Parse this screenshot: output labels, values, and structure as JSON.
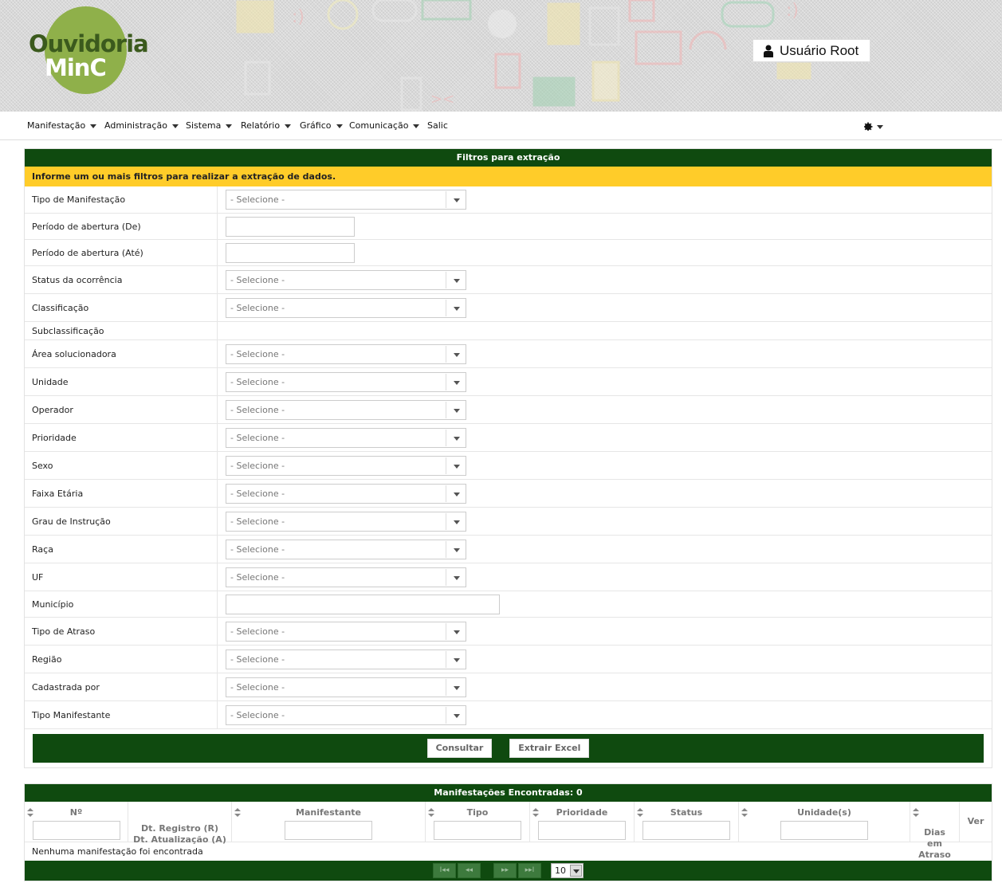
{
  "header": {
    "logo_line1": "Ouvidoria",
    "logo_line2": "MinC",
    "user_label": "Usuário Root"
  },
  "nav": {
    "items": [
      {
        "label": "Manifestação",
        "dropdown": true
      },
      {
        "label": "Administração",
        "dropdown": true
      },
      {
        "label": "Sistema",
        "dropdown": true
      },
      {
        "label": "Relatório",
        "dropdown": true
      },
      {
        "label": "Gráfico",
        "dropdown": true
      },
      {
        "label": "Comunicação",
        "dropdown": true
      },
      {
        "label": "Salic",
        "dropdown": false
      }
    ],
    "settings_icon": "gear-icon"
  },
  "filters": {
    "title": "Filtros para extração",
    "notice": "Informe um ou mais filtros para realizar a extração de dados.",
    "placeholder": "- Selecione -",
    "fields": [
      {
        "label": "Tipo de Manifestação",
        "kind": "select"
      },
      {
        "label": "Período de abertura (De)",
        "kind": "text"
      },
      {
        "label": "Período de abertura (Até)",
        "kind": "text"
      },
      {
        "label": "Status da ocorrência",
        "kind": "select"
      },
      {
        "label": "Classificação",
        "kind": "select"
      },
      {
        "label": "Subclassificação",
        "kind": "none"
      },
      {
        "label": "Área solucionadora",
        "kind": "select"
      },
      {
        "label": "Unidade",
        "kind": "select"
      },
      {
        "label": "Operador",
        "kind": "select"
      },
      {
        "label": "Prioridade",
        "kind": "select"
      },
      {
        "label": "Sexo",
        "kind": "select"
      },
      {
        "label": "Faixa Etária",
        "kind": "select"
      },
      {
        "label": "Grau de Instrução",
        "kind": "select"
      },
      {
        "label": "Raça",
        "kind": "select"
      },
      {
        "label": "UF",
        "kind": "select"
      },
      {
        "label": "Município",
        "kind": "wide-text"
      },
      {
        "label": "Tipo de Atraso",
        "kind": "select"
      },
      {
        "label": "Região",
        "kind": "select"
      },
      {
        "label": "Cadastrada por",
        "kind": "select"
      },
      {
        "label": "Tipo Manifestante",
        "kind": "select"
      }
    ],
    "consult_label": "Consultar",
    "export_label": "Extrair Excel"
  },
  "results": {
    "title": "Manifestações Encontradas: 0",
    "columns": [
      {
        "label": "Nº",
        "sortable": true,
        "filter": true
      },
      {
        "label": "Dt. Registro (R)\nDt. Atualização (A)",
        "sortable": false,
        "filter": false
      },
      {
        "label": "Manifestante",
        "sortable": true,
        "filter": true
      },
      {
        "label": "Tipo",
        "sortable": true,
        "filter": true
      },
      {
        "label": "Prioridade",
        "sortable": true,
        "filter": true
      },
      {
        "label": "Status",
        "sortable": true,
        "filter": true
      },
      {
        "label": "Unidade(s)",
        "sortable": true,
        "filter": true
      },
      {
        "label": "Dias\nem\nAtraso",
        "sortable": true,
        "filter": false
      },
      {
        "label": "Ver",
        "sortable": false,
        "filter": false
      }
    ],
    "empty_message": "Nenhuma manifestação foi encontrada",
    "pager": {
      "first": "I◂◂",
      "prev": "◂◂",
      "next": "▸▸",
      "last": "▸▸I",
      "page_size": "10"
    }
  }
}
